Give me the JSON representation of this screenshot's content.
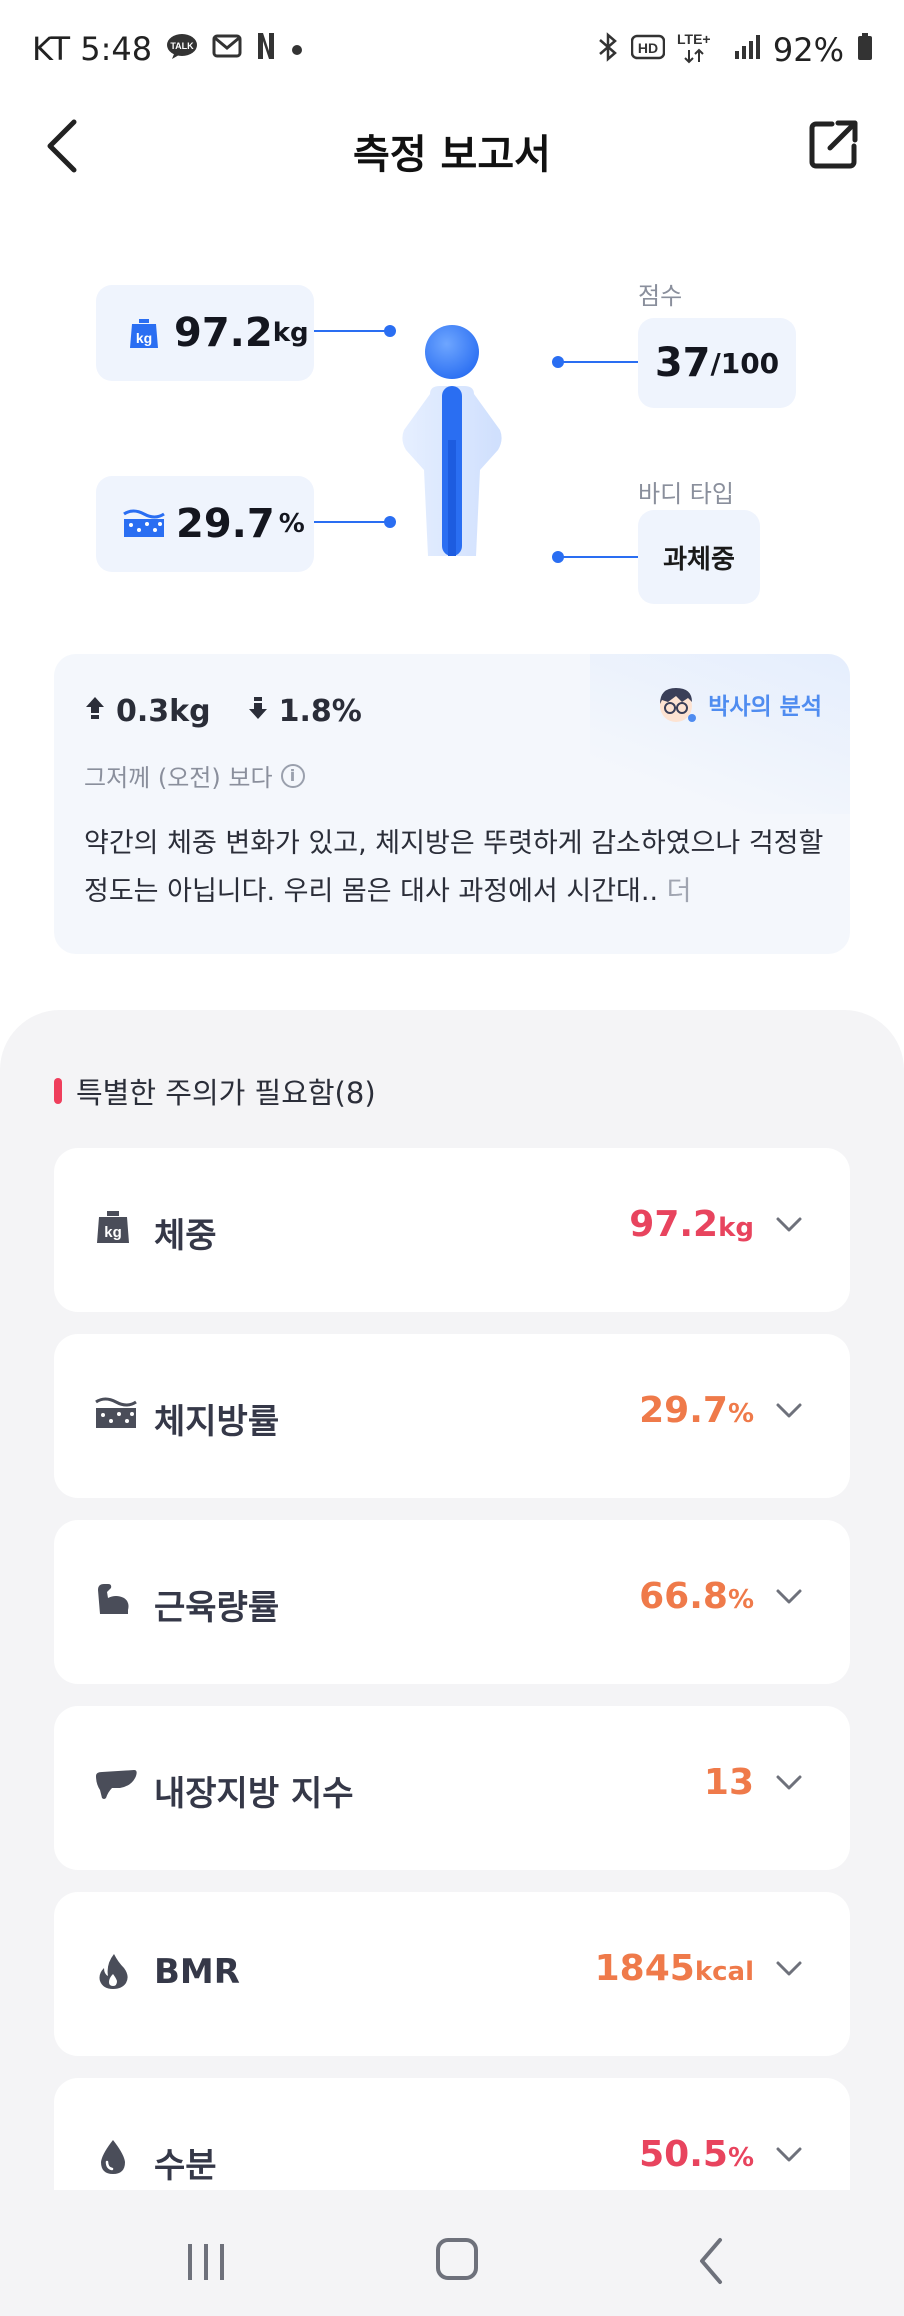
{
  "status_bar": {
    "carrier_time": "KT 5:48",
    "talk_icon_text": "TALK",
    "battery": "92%"
  },
  "header": {
    "title": "측정 보고서"
  },
  "summary": {
    "weight_value": "97.2",
    "weight_unit": "kg",
    "fat_value": "29.7",
    "fat_unit": "%",
    "score_label": "점수",
    "score_value": "37",
    "score_denominator": "/100",
    "body_type_label": "바디 타입",
    "body_type_value": "과체중"
  },
  "analysis": {
    "weight_change": "0.3kg",
    "fat_change": "1.8%",
    "compare_text": "그저께 (오전) 보다",
    "badge": "박사의 분석",
    "text": "약간의 체중 변화가 있고, 체지방은 뚜렷하게 감소하였으나 걱정할 정도는 아닙니다.  우리 몸은 대사 과정에서 시간대.. ",
    "more": "더"
  },
  "attention": {
    "title": "특별한 주의가 필요함(8)",
    "metrics": [
      {
        "name": "체중",
        "value": "97.2",
        "unit": "kg",
        "color": "#e8445e",
        "icon": "weight-icon"
      },
      {
        "name": "체지방률",
        "value": "29.7",
        "unit": "%",
        "color": "#ef7a4a",
        "icon": "body-fat-icon"
      },
      {
        "name": "근육량률",
        "value": "66.8",
        "unit": "%",
        "color": "#ef7a4a",
        "icon": "muscle-icon"
      },
      {
        "name": "내장지방 지수",
        "value": "13",
        "unit": "",
        "color": "#ef7a4a",
        "icon": "organ-icon"
      },
      {
        "name": "BMR",
        "value": "1845",
        "unit": "kcal",
        "color": "#ef7a4a",
        "icon": "flame-icon"
      },
      {
        "name": "수분",
        "value": "50.5",
        "unit": "%",
        "color": "#e8445e",
        "icon": "water-drop-icon"
      }
    ]
  }
}
